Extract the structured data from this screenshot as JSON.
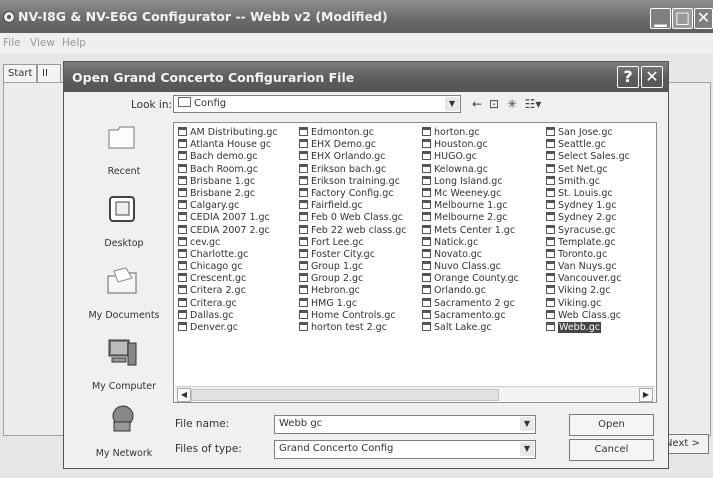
{
  "window": {
    "title": "NV-I8G & NV-E6G Configurator -- Webb v2 (Modified)",
    "min_glyph": "▁",
    "max_glyph": "□",
    "close_glyph": "✕"
  },
  "menu": [
    "File",
    "View",
    "Help"
  ],
  "tabs": [
    "Start",
    "II"
  ],
  "next_button": "Next >",
  "dialog": {
    "title": "Open Grand Concerto Configurarion File",
    "help_glyph": "?",
    "close_glyph": "✕",
    "look_in_label": "Look in:",
    "look_in_value": "Config",
    "places": [
      {
        "label": "Recent",
        "icon": "recent-icon"
      },
      {
        "label": "Desktop",
        "icon": "desktop-icon"
      },
      {
        "label": "My Documents",
        "icon": "my-documents-icon"
      },
      {
        "label": "My Computer",
        "icon": "my-computer-icon"
      },
      {
        "label": "My Network",
        "icon": "my-network-icon"
      }
    ],
    "files": [
      [
        "AM Distributing.gc",
        "Atlanta House gc",
        "Bach demo.gc",
        "Bach Room.gc",
        "Brisbane 1.gc",
        "Brisbane 2.gc",
        "Calgary.gc",
        "CEDIA 2007 1.gc",
        "CEDIA 2007 2.gc",
        "cev.gc",
        "Charlotte.gc",
        "Chicago gc",
        "Crescent.gc",
        "Critera 2.gc",
        "Critera.gc",
        "Dallas.gc",
        "Denver.gc"
      ],
      [
        "Edmonton.gc",
        "EHX Demo.gc",
        "EHX Orlando.gc",
        "Erikson bach.gc",
        "Erikson training.gc",
        "Factory Config.gc",
        "Fairfield.gc",
        "Feb 0 Web Class.gc",
        "Feb 22 web class.gc",
        "Fort Lee.gc",
        "Foster City.gc",
        "Group 1.gc",
        "Group 2.gc",
        "Hebron.gc",
        "HMG 1.gc",
        "Home Controls.gc",
        "horton test 2.gc"
      ],
      [
        "horton.gc",
        "Houston.gc",
        "HUGO.gc",
        "Kelowna.gc",
        "Long Island.gc",
        "Mc Weeney.gc",
        "Melbourne 1.gc",
        "Melbourne 2.gc",
        "Mets Center 1.gc",
        "Natick.gc",
        "Novato.gc",
        "Nuvo Class.gc",
        "Orange County.gc",
        "Orlando.gc",
        "Sacramento 2 gc",
        "Sacramento.gc",
        "Salt Lake.gc"
      ],
      [
        "San Jose.gc",
        "Seattle.gc",
        "Select Sales.gc",
        "Set Net.gc",
        "Smith.gc",
        "St. Louis.gc",
        "Sydney 1.gc",
        "Sydney 2.gc",
        "Syracuse.gc",
        "Template.gc",
        "Toronto.gc",
        "Van Nuys.gc",
        "Vancouver.gc",
        "Viking 2.gc",
        "Viking.gc",
        "Web Class.gc",
        "Webb.gc"
      ]
    ],
    "selected_file": "Webb.gc",
    "file_name_label": "File name:",
    "file_name_value": "Webb gc",
    "file_type_label": "Files of type:",
    "file_type_value": "Grand Concerto Config",
    "open_button": "Open",
    "cancel_button": "Cancel"
  }
}
